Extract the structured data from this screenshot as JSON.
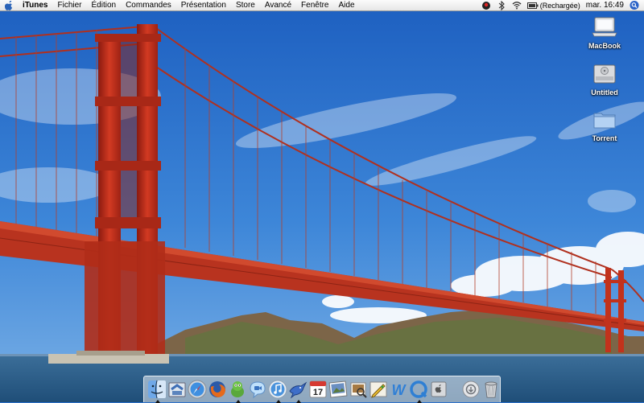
{
  "menubar": {
    "apple_icon": "apple-icon",
    "app_name": "iTunes",
    "menus": [
      "Fichier",
      "Édition",
      "Commandes",
      "Présentation",
      "Store",
      "Avancé",
      "Fenêtre",
      "Aide"
    ],
    "extras": [
      "status-icon",
      "bluetooth-icon",
      "wifi-icon"
    ],
    "battery": "(Rechargée)",
    "clock": "mar. 16:49",
    "spotlight_icon": "spotlight-icon"
  },
  "desktop": {
    "icons": [
      {
        "label": "MacBook",
        "icon": "laptop-icon"
      },
      {
        "label": "Untitled",
        "icon": "hard-drive-icon"
      },
      {
        "label": "Torrent",
        "icon": "folder-icon"
      }
    ]
  },
  "dock": {
    "apps": [
      {
        "icon": "finder-icon",
        "running": true
      },
      {
        "icon": "mail-icon",
        "running": false
      },
      {
        "icon": "safari-icon",
        "running": false
      },
      {
        "icon": "firefox-icon",
        "running": false
      },
      {
        "icon": "adium-icon",
        "running": true
      },
      {
        "icon": "ichat-icon",
        "running": false
      },
      {
        "icon": "itunes-icon",
        "running": true
      },
      {
        "icon": "bird-app-icon",
        "running": true
      },
      {
        "icon": "ical-icon",
        "running": false
      },
      {
        "icon": "photo-icon",
        "running": false
      },
      {
        "icon": "preview-icon",
        "running": false
      },
      {
        "icon": "pencil-app-icon",
        "running": false
      },
      {
        "icon": "w-app-icon",
        "running": false
      },
      {
        "icon": "q-app-icon",
        "running": true
      },
      {
        "icon": "system-preferences-icon",
        "running": false
      }
    ],
    "ical_date": "17",
    "stack_icons": [
      "downloads-stack-icon",
      "trash-icon"
    ]
  }
}
